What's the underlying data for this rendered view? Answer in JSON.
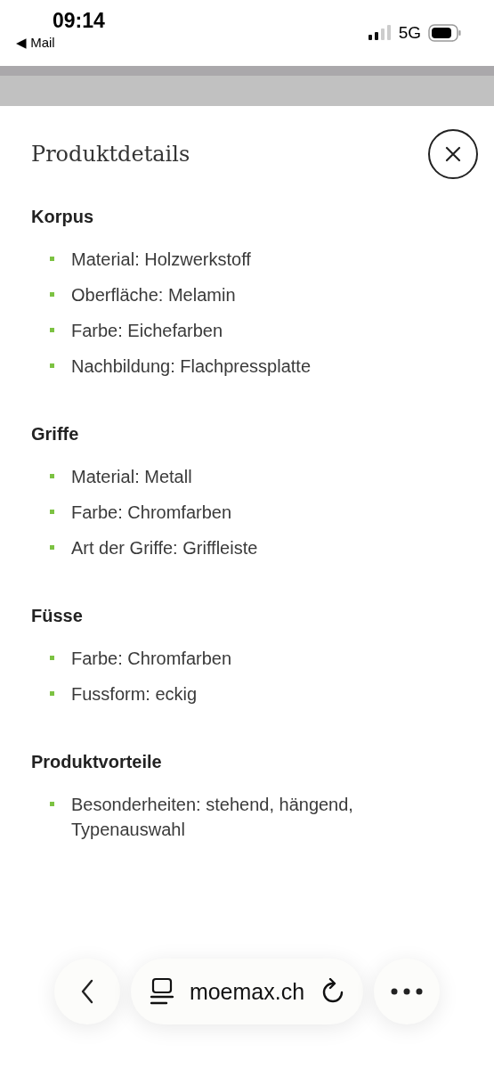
{
  "status_bar": {
    "time": "09:14",
    "back_app": "◀ Mail",
    "network": "5G"
  },
  "title": "Produktdetails",
  "sections": [
    {
      "heading": "Korpus",
      "items": [
        "Material: Holzwerkstoff",
        "Oberfläche: Melamin",
        "Farbe: Eichefarben",
        "Nachbildung: Flachpressplatte"
      ]
    },
    {
      "heading": "Griffe",
      "items": [
        "Material: Metall",
        "Farbe: Chromfarben",
        "Art der Griffe: Griffleiste"
      ]
    },
    {
      "heading": "Füsse",
      "items": [
        "Farbe: Chromfarben",
        "Fussform: eckig"
      ]
    },
    {
      "heading": "Produktvorteile",
      "items": [
        "Besonderheiten: stehend, hängend, Typenauswahl"
      ]
    }
  ],
  "browser_bar": {
    "url": "moemax.ch"
  }
}
